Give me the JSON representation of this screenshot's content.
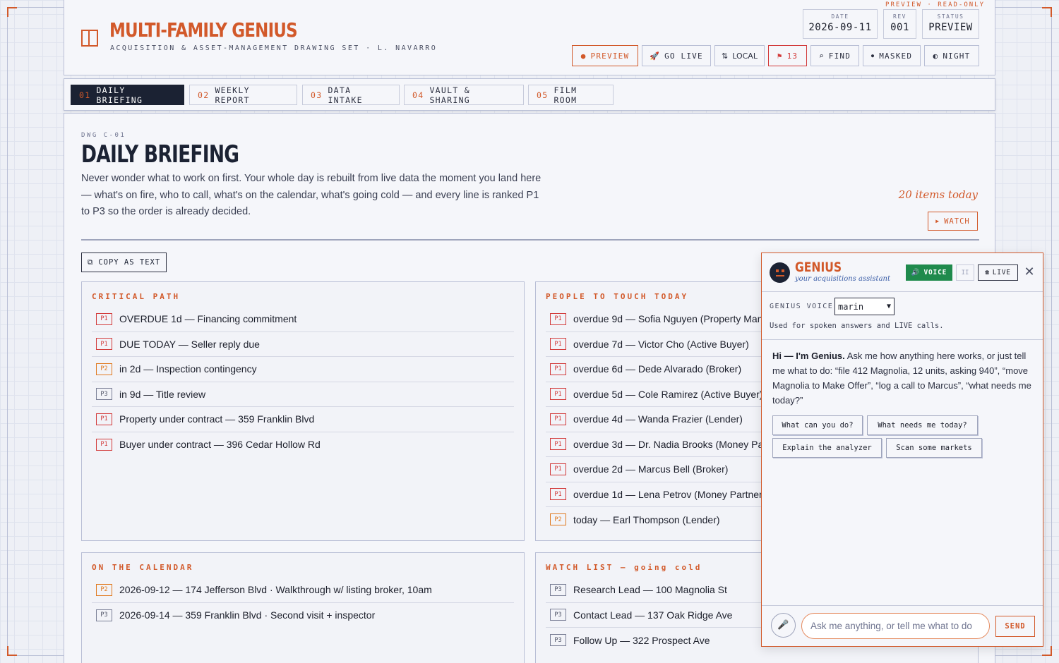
{
  "header": {
    "preview_tag": "PREVIEW · READ-ONLY",
    "title": "MULTI-FAMILY GENIUS",
    "subtitle": "ACQUISITION & ASSET-MANAGEMENT DRAWING SET · L. NAVARRO",
    "meta": [
      {
        "label": "DATE",
        "value": "2026-09-11"
      },
      {
        "label": "REV",
        "value": "001"
      },
      {
        "label": "STATUS",
        "value": "PREVIEW"
      }
    ],
    "buttons": {
      "preview": "PREVIEW",
      "go_live": "GO LIVE",
      "local": "LOCAL",
      "flags": "13",
      "find": "FIND",
      "masked": "MASKED",
      "night": "NIGHT"
    }
  },
  "tabs": [
    {
      "num": "01",
      "label": "DAILY BRIEFING"
    },
    {
      "num": "02",
      "label": "WEEKLY REPORT"
    },
    {
      "num": "03",
      "label": "DATA INTAKE"
    },
    {
      "num": "04",
      "label": "VAULT & SHARING"
    },
    {
      "num": "05",
      "label": "FILM ROOM"
    }
  ],
  "main": {
    "dwg": "DWG C-01",
    "title": "DAILY BRIEFING",
    "description": "Never wonder what to work on first. Your whole day is rebuilt from live data the moment you land here — what's on fire, who to call, what's on the calendar, what's going cold — and every line is ranked P1 to P3 so the order is already decided.",
    "items_today": "20 items today",
    "watch_label": "WATCH",
    "copy_label": "COPY AS TEXT"
  },
  "panels": {
    "critical": {
      "title": "CRITICAL PATH",
      "items": [
        {
          "p": "P1",
          "text": "OVERDUE 1d — Financing commitment"
        },
        {
          "p": "P1",
          "text": "DUE TODAY — Seller reply due"
        },
        {
          "p": "P2",
          "text": "in 2d — Inspection contingency"
        },
        {
          "p": "P3",
          "text": "in 9d — Title review"
        },
        {
          "p": "P1",
          "text": "Property under contract — 359 Franklin Blvd"
        },
        {
          "p": "P1",
          "text": "Buyer under contract — 396 Cedar Hollow Rd"
        }
      ]
    },
    "people": {
      "title": "PEOPLE TO TOUCH TODAY",
      "items": [
        {
          "p": "P1",
          "text": "overdue 9d — Sofia Nguyen (Property Manager)"
        },
        {
          "p": "P1",
          "text": "overdue 7d — Victor Cho (Active Buyer)"
        },
        {
          "p": "P1",
          "text": "overdue 6d — Dede Alvarado (Broker)"
        },
        {
          "p": "P1",
          "text": "overdue 5d — Cole Ramirez (Active Buyer)"
        },
        {
          "p": "P1",
          "text": "overdue 4d — Wanda Frazier (Lender)"
        },
        {
          "p": "P1",
          "text": "overdue 3d — Dr. Nadia Brooks (Money Partner)"
        },
        {
          "p": "P1",
          "text": "overdue 2d — Marcus Bell (Broker)"
        },
        {
          "p": "P1",
          "text": "overdue 1d — Lena Petrov (Money Partner)"
        },
        {
          "p": "P2",
          "text": "today — Earl Thompson (Lender)"
        }
      ]
    },
    "calendar": {
      "title": "ON THE CALENDAR",
      "items": [
        {
          "p": "P2",
          "text": "2026-09-12 — 174 Jefferson Blvd · Walkthrough w/ listing broker, 10am"
        },
        {
          "p": "P3",
          "text": "2026-09-14 — 359 Franklin Blvd · Second visit + inspector"
        }
      ]
    },
    "watch": {
      "title": "WATCH LIST — going cold",
      "items": [
        {
          "p": "P3",
          "text": "Research Lead — 100 Magnolia St"
        },
        {
          "p": "P3",
          "text": "Contact Lead — 137 Oak Ridge Ave"
        },
        {
          "p": "P3",
          "text": "Follow Up — 322 Prospect Ave"
        }
      ]
    }
  },
  "chat": {
    "name": "GENIUS",
    "tagline": "your acquisitions assistant",
    "voice_label": "VOICE",
    "pause_label": "II",
    "live_label": "LIVE",
    "voice_setting_label": "GENIUS VOICE",
    "voice_selected": "marin",
    "voice_note": "Used for spoken answers and LIVE calls.",
    "greeting_bold": "Hi — I'm Genius.",
    "greeting": "Ask me how anything here works, or just tell me what to do: “file 412 Magnolia, 12 units, asking 940”, “move Magnolia to Make Offer”, “log a call to Marcus”, “what needs me today?”",
    "chips": [
      "What can you do?",
      "What needs me today?",
      "Explain the analyzer",
      "Scan some markets"
    ],
    "input_placeholder": "Ask me anything, or tell me what to do",
    "send_label": "SEND"
  },
  "colors": {
    "accent": "#d2592a",
    "ink": "#1b2233",
    "p1": "#d23a3a",
    "p2": "#e0791f",
    "live_green": "#1f8a4c"
  }
}
